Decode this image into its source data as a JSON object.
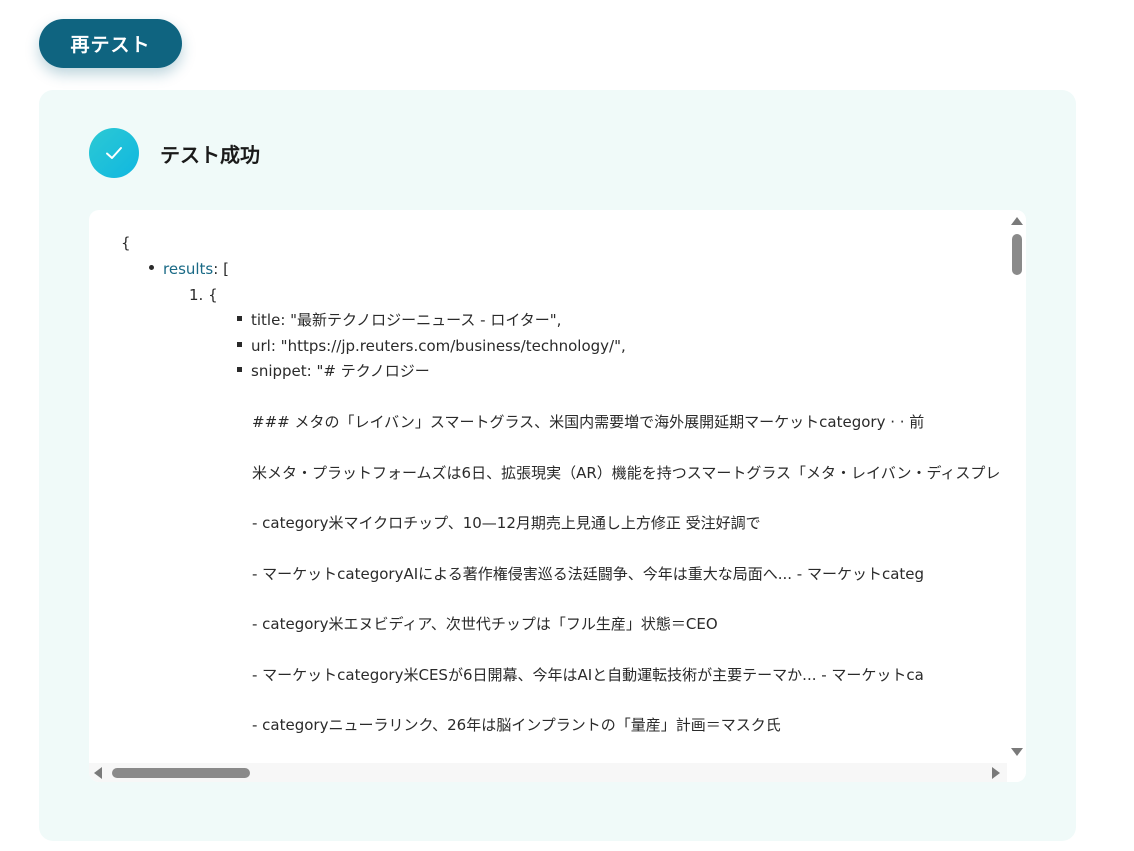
{
  "retest_button": {
    "label": "再テスト"
  },
  "status": {
    "text": "テスト成功",
    "icon": "check-icon",
    "color": "#1fc0dc"
  },
  "colors": {
    "primary": "#0f6480",
    "panel_bg": "#f0faf9",
    "key": "#1a6a86"
  },
  "code": {
    "open_brace": "{",
    "results_key": "results",
    "results_suffix": ": [",
    "item_number": "1. {",
    "lines": [
      "title: \"最新テクノロジーニュース - ロイター\",",
      "url: \"https://jp.reuters.com/business/technology/\",",
      "snippet: \"# テクノロジー"
    ],
    "snippet_lines": [
      "### メタの「レイバン」スマートグラス、米国内需要増で海外展開延期マーケットcategory · · 前",
      "米メタ・プラットフォームズは6日、拡張現実（AR）機能を持つスマートグラス「メタ・レイバン・ディスプレ",
      "- category米マイクロチップ、10—12月期売上見通し上方修正 受注好調で",
      "- マーケットcategoryAIによる著作権侵害巡る法廷闘争、今年は重大な局面へ... - マーケットcateg",
      "- category米エヌビディア、次世代チップは「フル生産」状態＝CEO",
      "- マーケットcategory米CESが6日開幕、今年はAIと自動運転技術が主要テーマか... - マーケットca",
      "- categoryニューラリンク、26年は脳インプラントの「量産」計画＝マスク氏"
    ]
  }
}
